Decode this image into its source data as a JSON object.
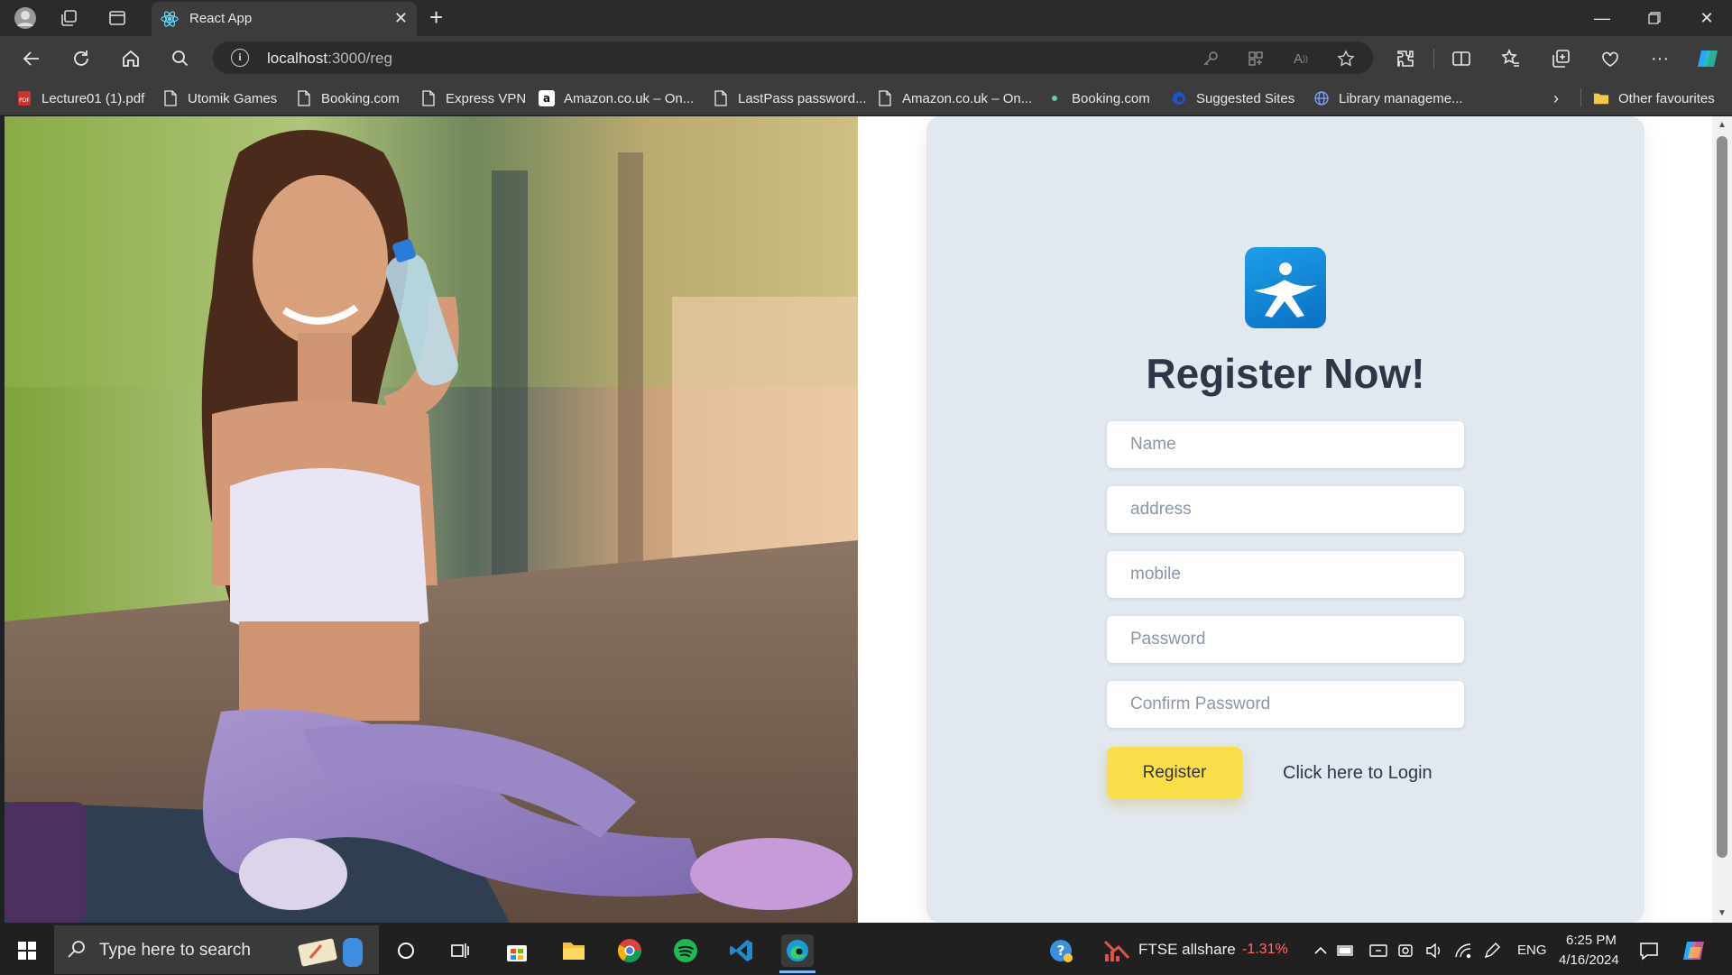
{
  "browser": {
    "tab_title": "React App",
    "url_host": "localhost",
    "url_path": ":3000/reg",
    "bookmarks": [
      {
        "label": "Lecture01 (1).pdf",
        "icon": "pdf-icon"
      },
      {
        "label": "Utomik Games",
        "icon": "page-icon"
      },
      {
        "label": "Booking.com",
        "icon": "page-icon"
      },
      {
        "label": "Express VPN",
        "icon": "page-icon"
      },
      {
        "label": "Amazon.co.uk – On...",
        "icon": "amazon-icon"
      },
      {
        "label": "LastPass password...",
        "icon": "page-icon"
      },
      {
        "label": "Amazon.co.uk – On...",
        "icon": "page-icon"
      },
      {
        "label": "Booking.com",
        "icon": "dot-icon"
      },
      {
        "label": "Suggested Sites",
        "icon": "edge-icon"
      },
      {
        "label": "Library manageme...",
        "icon": "globe-icon"
      }
    ],
    "other_favourites": "Other favourites"
  },
  "page": {
    "heading": "Register Now!",
    "fields": {
      "name_placeholder": "Name",
      "address_placeholder": "address",
      "mobile_placeholder": "mobile",
      "password_placeholder": "Password",
      "confirm_placeholder": "Confirm Password"
    },
    "register_button": "Register",
    "login_link": "Click here to Login"
  },
  "taskbar": {
    "search_placeholder": "Type here to search",
    "stock_name": "FTSE allshare",
    "stock_change": "-1.31%",
    "language": "ENG",
    "time": "6:25 PM",
    "date": "4/16/2024"
  },
  "colors": {
    "card_bg": "#e2e8f0",
    "register_button": "#fbde4a",
    "heading_text": "#2d3748",
    "stock_negative": "#ff6a6a"
  }
}
